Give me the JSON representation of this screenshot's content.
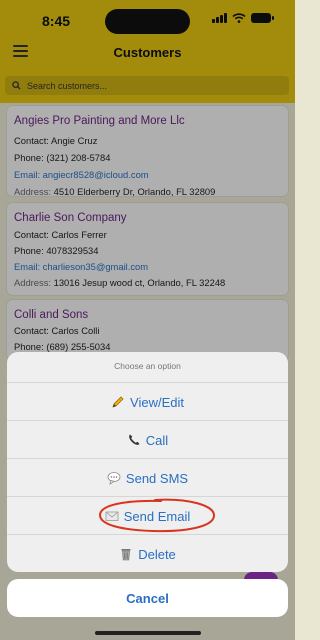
{
  "status": {
    "time": "8:45"
  },
  "header": {
    "title": "Customers"
  },
  "search": {
    "placeholder": "Search customers..."
  },
  "customers": [
    {
      "name": "Angies Pro Painting and More Llc",
      "contact_label": "Contact:",
      "contact": "Angie Cruz",
      "phone_label": "Phone:",
      "phone": "(321) 208-5784",
      "email_label": "Email:",
      "email": "angiecr8528@icloud.com",
      "address_label": "Address:",
      "address": "4510 Elderberry Dr, Orlando, FL 32809"
    },
    {
      "name": "Charlie Son Company",
      "contact_label": "Contact:",
      "contact": "Carlos Ferrer",
      "phone_label": "Phone:",
      "phone": "4078329534",
      "email_label": "Email:",
      "email": "charlieson35@gmail.com",
      "address_label": "Address:",
      "address": "13016 Jesup wood ct, Orlando, FL 32248"
    },
    {
      "name": "Colli and Sons",
      "contact_label": "Contact:",
      "contact": "Carlos Colli",
      "phone_label": "Phone:",
      "phone": "(689) 255-5034"
    }
  ],
  "action_sheet": {
    "title": "Choose an option",
    "options": [
      {
        "label": "View/Edit",
        "icon": "pencil-icon"
      },
      {
        "label": "Call",
        "icon": "phone-icon"
      },
      {
        "label": "Send SMS",
        "icon": "speech-bubble-icon"
      },
      {
        "label": "Send Email",
        "icon": "envelope-icon"
      },
      {
        "label": "Delete",
        "icon": "trash-icon"
      }
    ],
    "cancel": "Cancel"
  },
  "colors": {
    "header": "#e2c311",
    "accent": "#2a6fc2",
    "name": "#6a2481",
    "annotation": "#d9341f"
  }
}
